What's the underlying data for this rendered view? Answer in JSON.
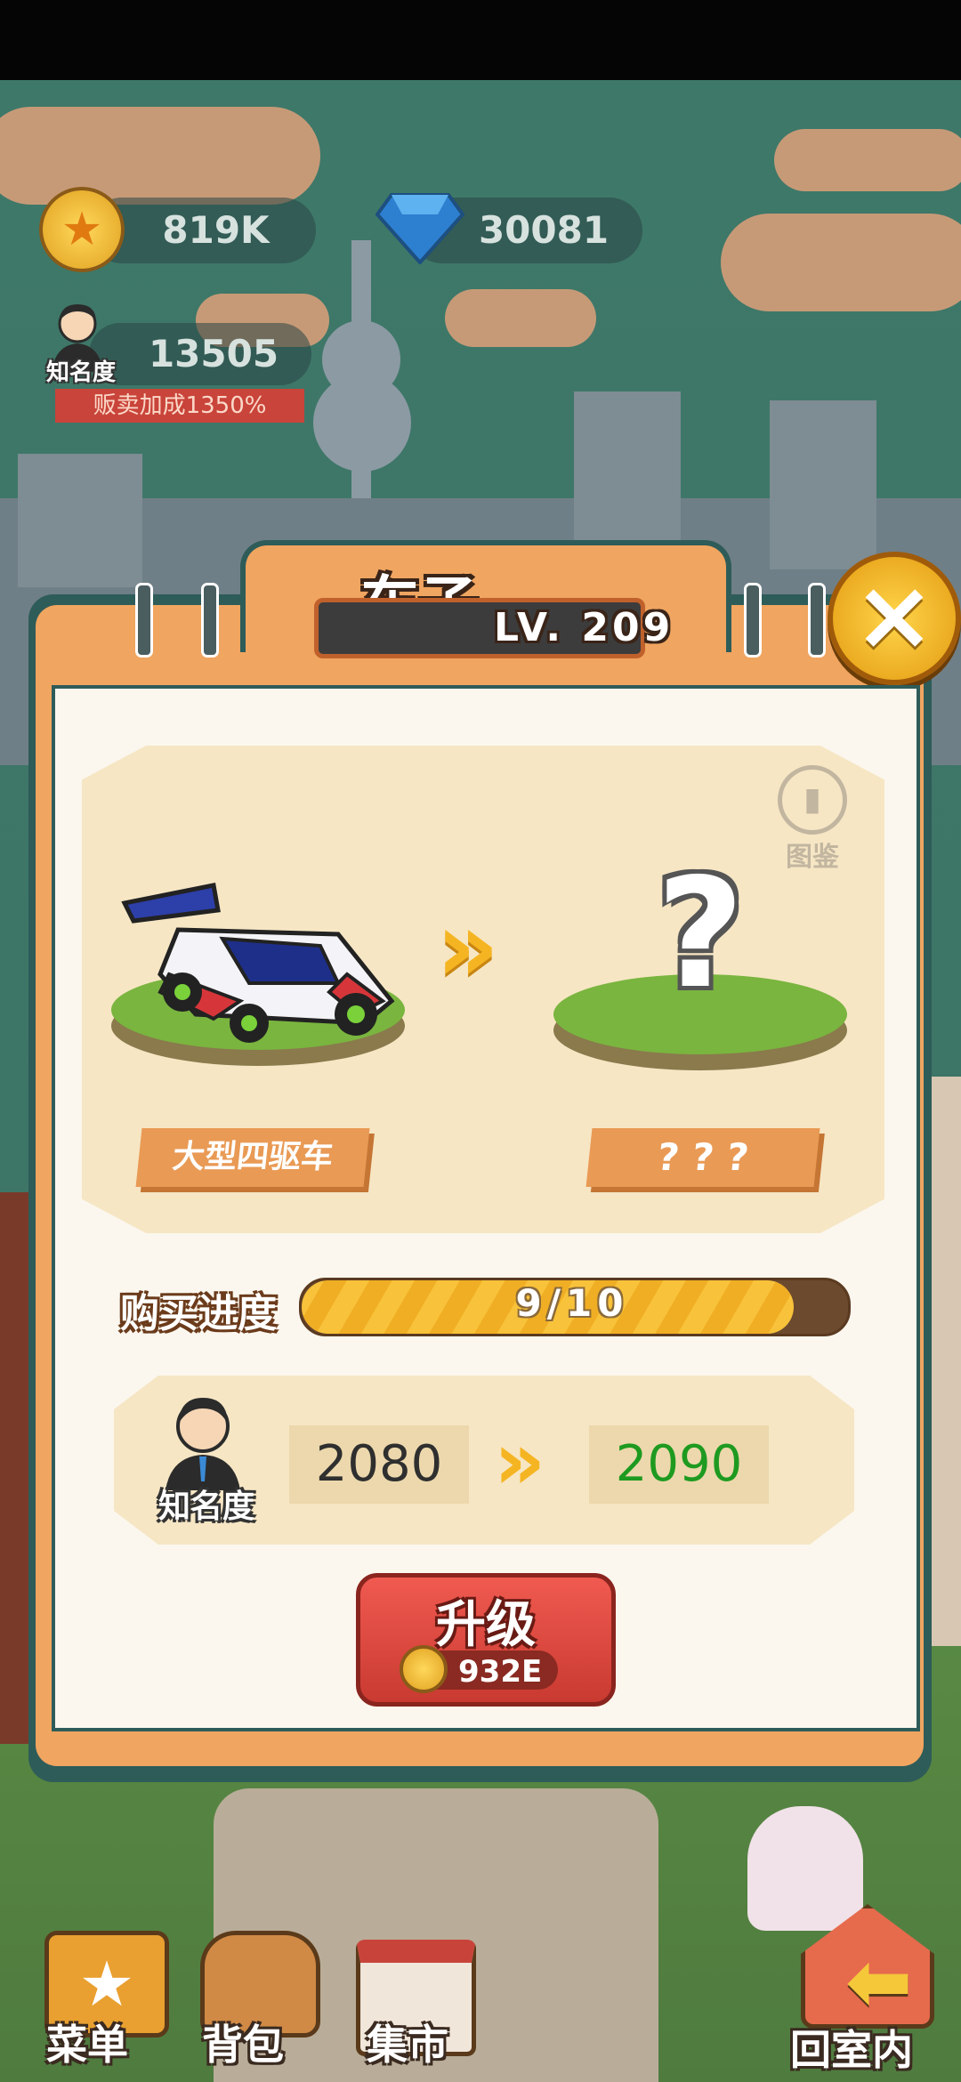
{
  "hud": {
    "coins": "819K",
    "gems": "30081",
    "fame_value": "13505",
    "fame_label": "知名度",
    "sell_bonus": "贩卖加成1350%"
  },
  "dialog": {
    "title": "车子",
    "level": "LV. 209",
    "collection_label": "图鉴",
    "current_item_name": "大型四驱车",
    "next_item_name": "? ? ?",
    "next_item_glyph": "?",
    "progress_label": "购买进度",
    "progress_text": "9/10",
    "progress_fraction": 0.9,
    "fame_label": "知名度",
    "fame_from": "2080",
    "fame_to": "2090",
    "upgrade_label": "升级",
    "upgrade_cost": "932E"
  },
  "nav": {
    "menu": "菜单",
    "backpack": "背包",
    "market": "集市",
    "go_home": "回室内"
  },
  "colors": {
    "accent_orange": "#f0a560",
    "fame_to_green": "#1e9a20",
    "button_red": "#d8443b"
  }
}
